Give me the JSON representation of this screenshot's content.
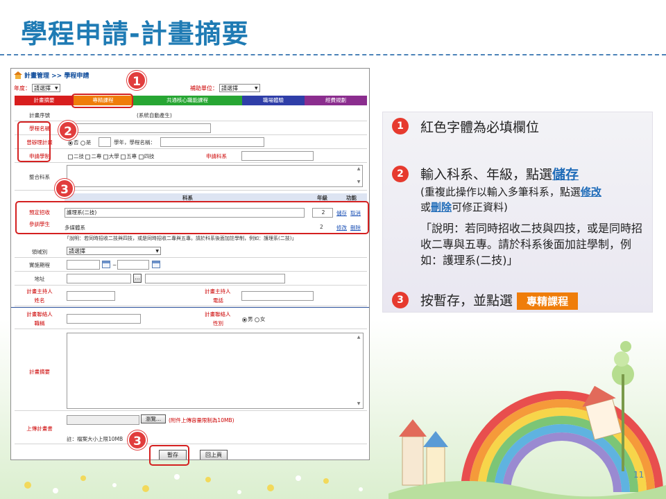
{
  "slide": {
    "title": "學程申請-計畫摘要",
    "page_number": "11"
  },
  "shot": {
    "breadcrumb": "計畫管理 >> 學程申請",
    "year_label": "年度：",
    "year_value": "請選擇",
    "unit_label": "補助單位：",
    "unit_value": "請選擇",
    "tabs": [
      "計畫摘要",
      "專精課程",
      "共通核心職能課程",
      "職場體驗",
      "經費規劃"
    ],
    "plan_no_label": "計畫序號",
    "plan_no_note": "(系統自動產生)",
    "program_name_label": "學程名稱",
    "prev_plan_label": "曾辦理計畫",
    "prev_plan_options": [
      "否",
      "是"
    ],
    "prev_plan_note": "學年，學程名稱：",
    "system_label": "申請學制",
    "system_options": [
      "二技",
      "二專",
      "大學",
      "五專",
      "四技"
    ],
    "dept_label": "申請科系",
    "integrated_label": "整合科系",
    "dept_table_headers": [
      "科系",
      "年級",
      "功能"
    ],
    "recruit_label_1": "預定招收",
    "recruit_label_2": "參訓學生",
    "dept_rows": [
      {
        "name": "護理系(二技)",
        "grade": "2",
        "actions": [
          "儲存",
          "取消"
        ]
      },
      {
        "name": "多媒體系",
        "grade": "2",
        "actions": [
          "修改",
          "刪除"
        ]
      }
    ],
    "dept_note": "「說明：若同時招收二技與四技，或是同時招收二專與五專。請於科系後面加註學制，例如：護理系(二技)」",
    "field_label": "領域別",
    "field_value": "請選擇",
    "period_label": "實施期程",
    "period_sep": "~",
    "address_label": "地址",
    "address_btn": "...",
    "host_name_label": [
      "計畫主持人",
      "姓名"
    ],
    "host_phone_label": [
      "計畫主持人",
      "電話"
    ],
    "contact_title_label": [
      "計畫聯絡人",
      "職稱"
    ],
    "contact_gender_label": [
      "計畫聯絡人",
      "性別"
    ],
    "gender_options": [
      "男",
      "女"
    ],
    "summary_label": "計畫摘要",
    "upload_label": "上傳計畫書",
    "browse_btn": "瀏覽...",
    "upload_note": "(附件上傳容量限制為10MB)",
    "upload_hint": "註：檔案大小上限10MB",
    "save_btn": "暫存",
    "back_btn": "回上頁"
  },
  "markers": [
    "1",
    "2",
    "3",
    "3"
  ],
  "notes": {
    "n1_num": "1",
    "n1_text": "紅色字體為必填欄位",
    "n2_num": "2",
    "n2_text_a": "輸入科系、年級，點選",
    "n2_link": "儲存",
    "n2_sub_a": "(重複此操作以輸入多筆科系，點選",
    "n2_sub_link1": "修改",
    "n2_sub_b": "或",
    "n2_sub_link2": "刪除",
    "n2_sub_c": "可修正資料)",
    "n2_sub_d": "「說明：若同時招收二技與四技，或是同時招收二專與五專。請於科系後面加註學制，例如：護理系(二技)」",
    "n3_num": "3",
    "n3_text": "按暫存，並點選",
    "n3_button": "專精課程"
  },
  "colors": {
    "title": "#1f7bb4",
    "marker": "#e13d3d",
    "required": "#cc0000",
    "link": "#1e6bb8",
    "tab_course": "#ef7d0a"
  }
}
